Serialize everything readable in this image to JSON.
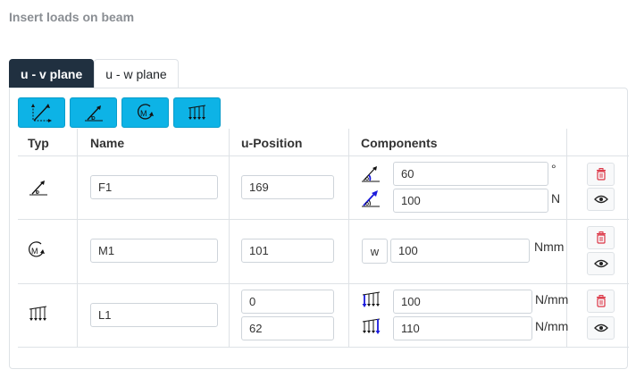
{
  "page": {
    "heading": "Insert loads on beam"
  },
  "tabs": [
    {
      "label": "u - v plane",
      "active": true
    },
    {
      "label": "u - w plane",
      "active": false
    }
  ],
  "toolbar": {
    "buttons": [
      {
        "icon": "force-components-icon"
      },
      {
        "icon": "inclined-force-icon"
      },
      {
        "icon": "moment-icon"
      },
      {
        "icon": "distributed-load-icon"
      }
    ],
    "color": "#0db3e6"
  },
  "table": {
    "headers": {
      "typ": "Typ",
      "name": "Name",
      "u_position": "u-Position",
      "components": "Components"
    },
    "rows": [
      {
        "type_icon": "inclined-force-icon",
        "name": "F1",
        "u_positions": [
          "169"
        ],
        "components": [
          {
            "icon": "force-angle-icon",
            "value": "60",
            "unit": "°"
          },
          {
            "icon": "force-magnitude-icon",
            "value": "100",
            "unit": "N"
          }
        ]
      },
      {
        "type_icon": "moment-icon",
        "name": "M1",
        "u_positions": [
          "101"
        ],
        "components": [
          {
            "prefix": "w",
            "value": "100",
            "unit": "Nmm"
          }
        ]
      },
      {
        "type_icon": "distributed-load-icon",
        "name": "L1",
        "u_positions": [
          "0",
          "62"
        ],
        "components": [
          {
            "icon": "load-start-icon",
            "value": "100",
            "unit": "N/mm"
          },
          {
            "icon": "load-end-icon",
            "value": "110",
            "unit": "N/mm"
          }
        ]
      }
    ]
  },
  "colors": {
    "tab_active": "#203040",
    "delete": "#dc3545",
    "accent_blue": "#1a1adc"
  }
}
